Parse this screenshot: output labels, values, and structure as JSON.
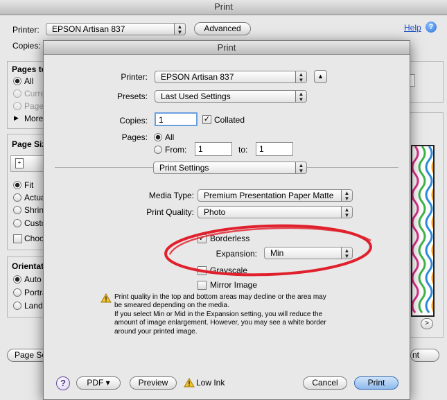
{
  "bg": {
    "title": "Print",
    "printer_label": "Printer:",
    "printer_value": "EPSON Artisan 837",
    "advanced_label": "Advanced",
    "help_label": "Help",
    "copies_label": "Copies:",
    "pages_group_title": "Pages to",
    "pages_all": "All",
    "pages_current": "Curre",
    "pages_pages": "Pages",
    "pages_more": "More",
    "page_size_title": "Page Size",
    "scale_fit": "Fit",
    "scale_actual": "Actua",
    "scale_shrink": "Shrink",
    "scale_custom": "Custo",
    "choose_label": "Choos",
    "orientation_title": "Orientatio",
    "orient_auto": "Auto",
    "orient_portrait": "Portra",
    "orient_landscape": "Lands",
    "page_setup_label": "Page Set",
    "print_label": "nt",
    "next_arrow": ">"
  },
  "dialog": {
    "title": "Print",
    "printer_label": "Printer:",
    "printer_value": "EPSON Artisan 837",
    "presets_label": "Presets:",
    "presets_value": "Last Used Settings",
    "copies_label": "Copies:",
    "copies_value": "1",
    "collated_label": "Collated",
    "pages_label": "Pages:",
    "pages_all": "All",
    "pages_from": "From:",
    "from_value": "1",
    "to_label": "to:",
    "to_value": "1",
    "section_value": "Print Settings",
    "media_type_label": "Media Type:",
    "media_type_value": "Premium Presentation Paper Matte",
    "print_quality_label": "Print Quality:",
    "print_quality_value": "Photo",
    "borderless_label": "Borderless",
    "expansion_label": "Expansion:",
    "expansion_value": "Min",
    "grayscale_label": "Grayscale",
    "mirror_label": "Mirror Image",
    "note_lines": [
      "Print quality in the top and bottom areas may decline or the area may",
      "be smeared depending on the media.",
      "If you select Min or Mid in the Expansion setting, you will reduce the",
      "amount of image enlargement. However, you may see a white border",
      "around your printed image."
    ],
    "help_symbol": "?",
    "pdf_label": "PDF ▾",
    "preview_label": "Preview",
    "low_ink_label": "Low Ink",
    "cancel_label": "Cancel",
    "print_label": "Print"
  },
  "colors": {
    "annotation_ellipse": "#e0202c",
    "accent_blue": "#2a6fd6"
  }
}
